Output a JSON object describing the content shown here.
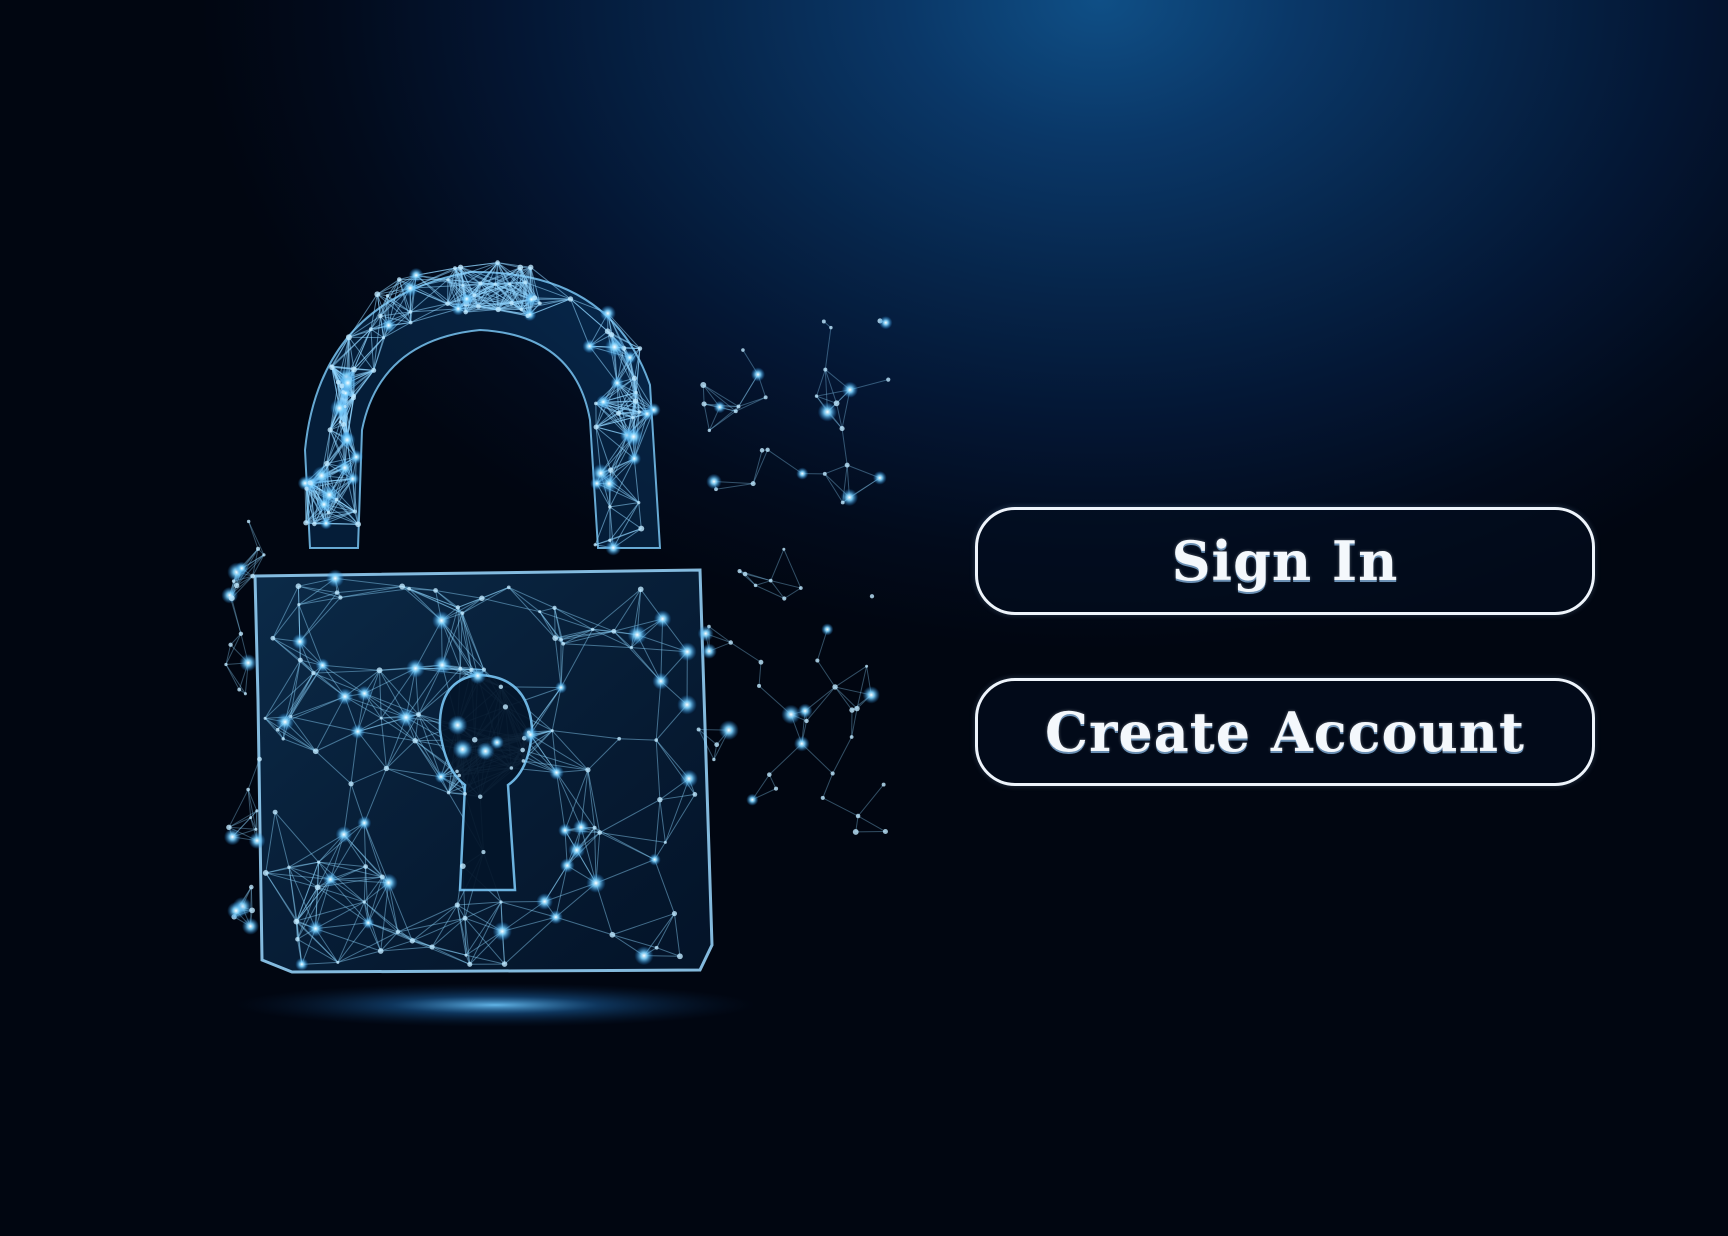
{
  "background": {
    "accent_color": "#0f4f86",
    "base_color": "#020814",
    "graphic": "padlock-network-icon"
  },
  "auth": {
    "sign_in_label": "Sign In",
    "create_account_label": "Create Account"
  }
}
